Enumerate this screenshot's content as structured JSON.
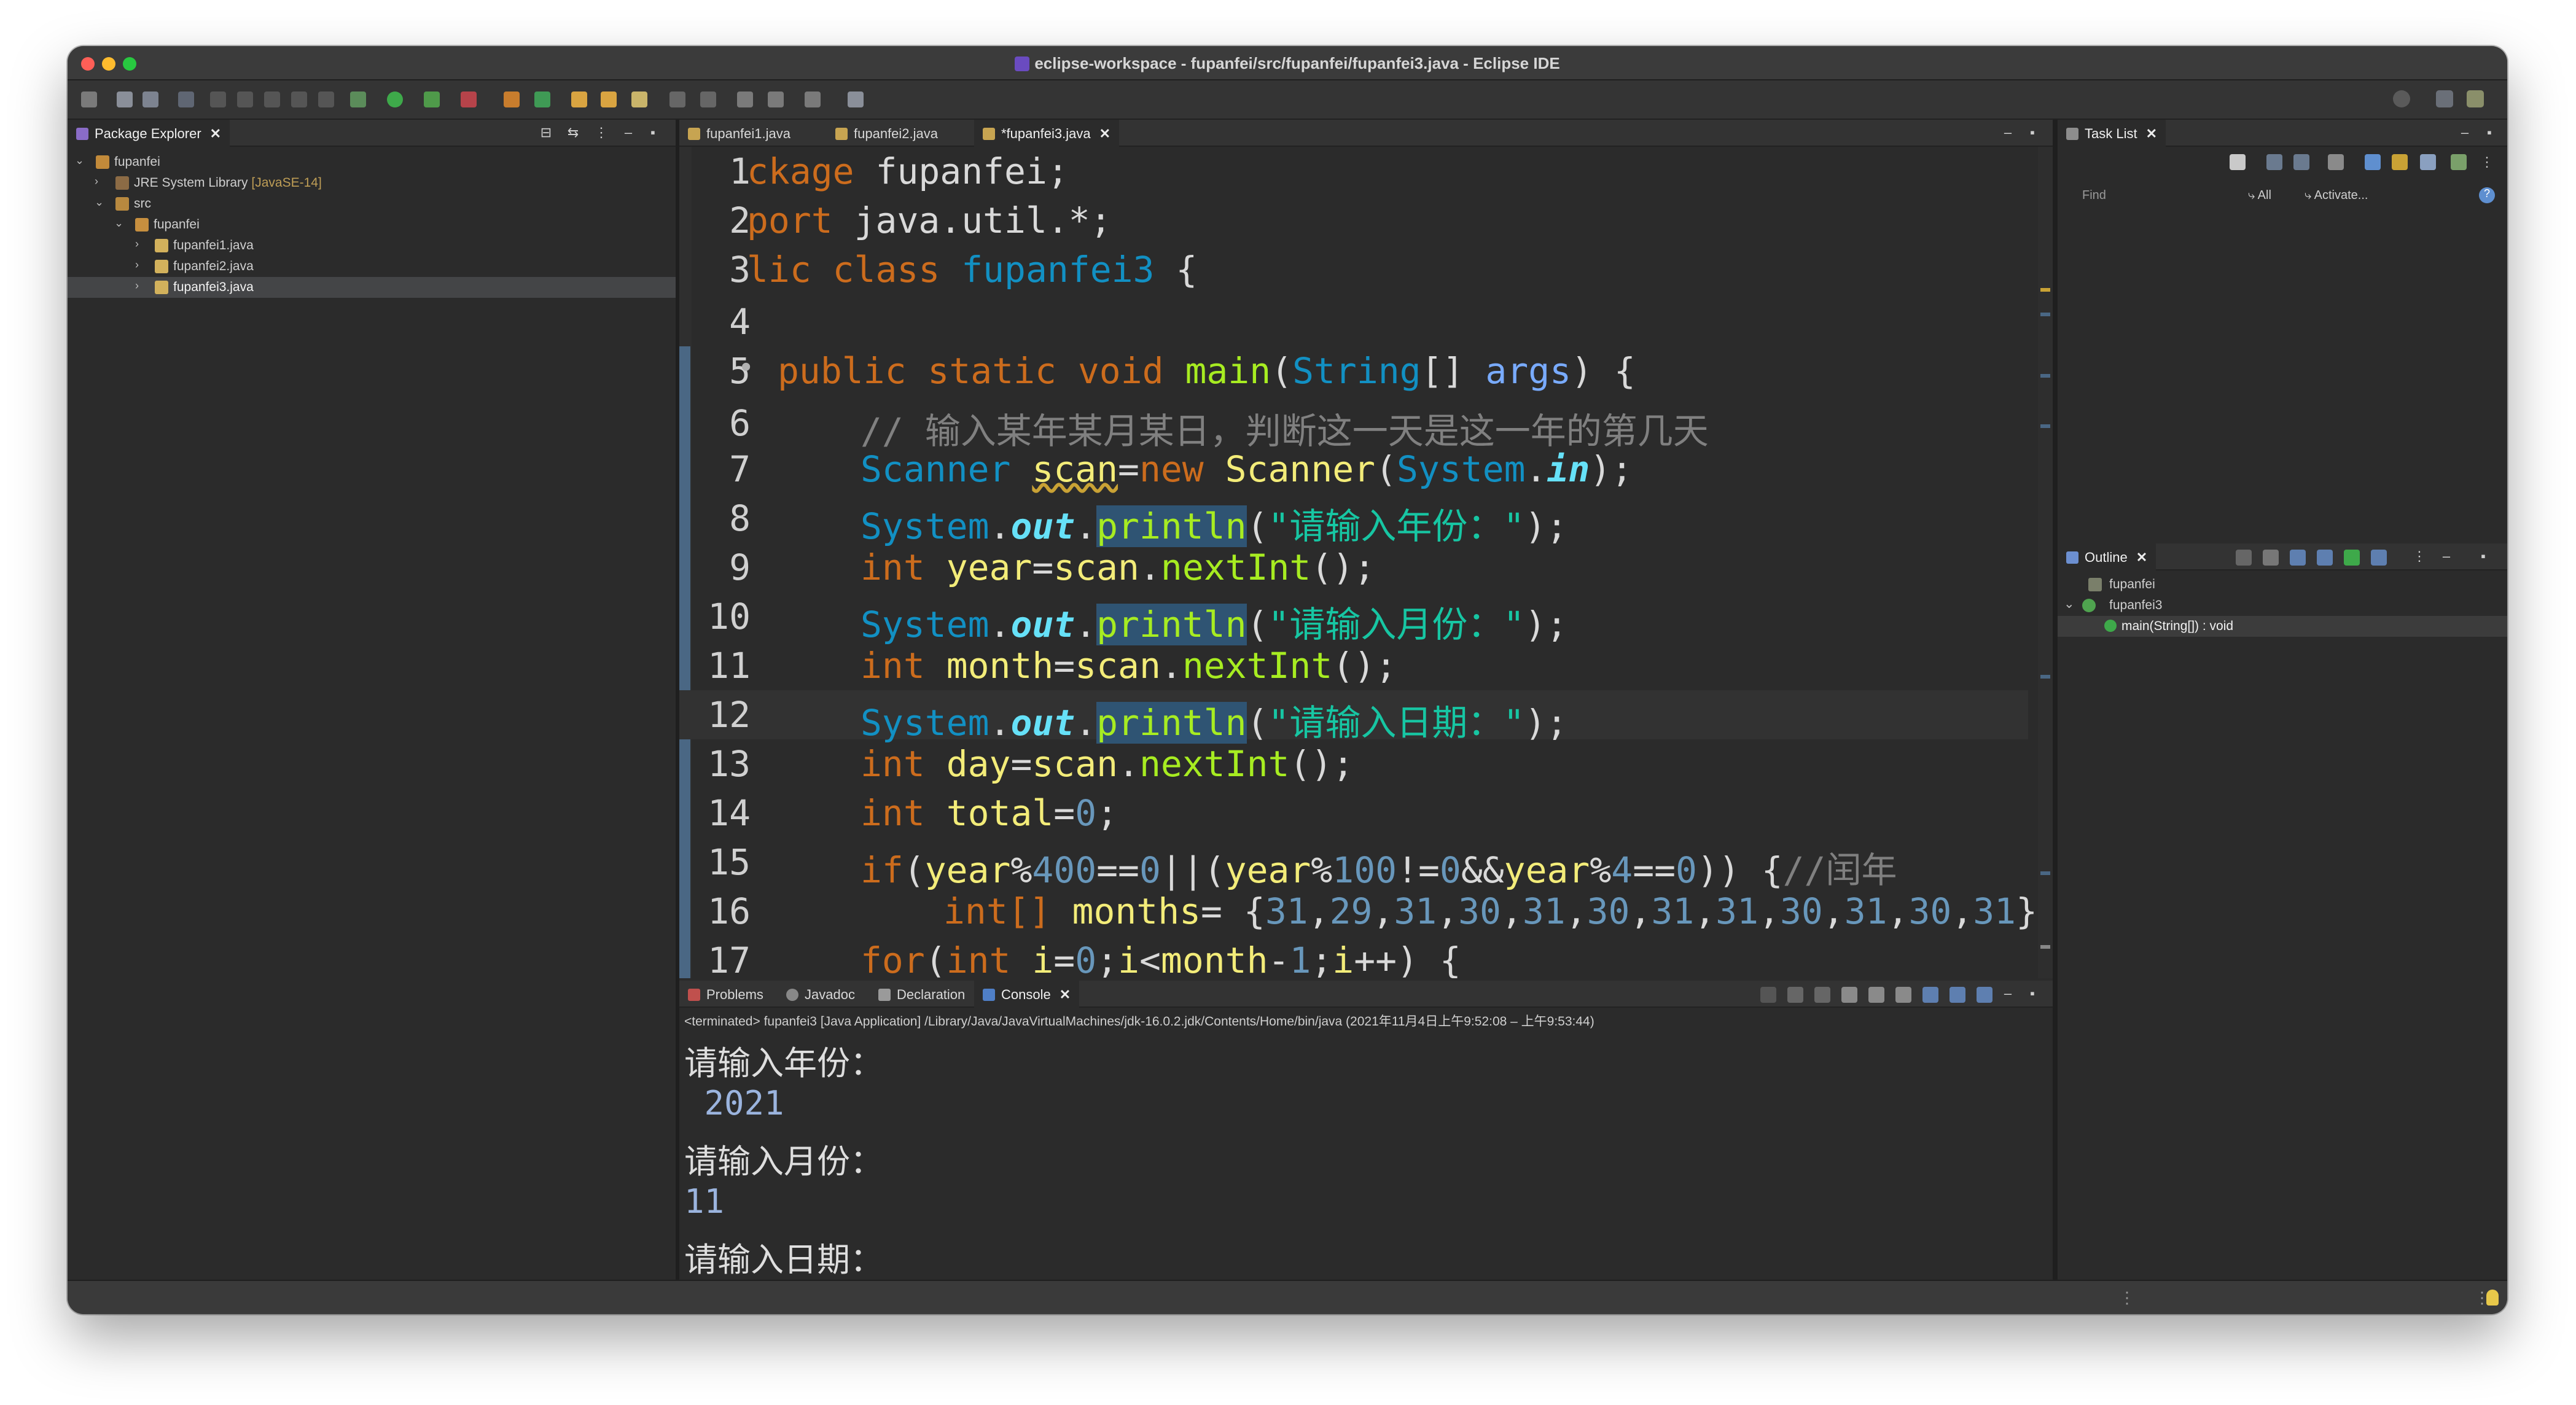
{
  "window": {
    "title": "eclipse-workspace - fupanfei/src/fupanfei/fupanfei3.java - Eclipse IDE"
  },
  "package_explorer": {
    "tab_label": "Package Explorer",
    "tree": [
      {
        "label": "fupanfei",
        "icon": "project-icon",
        "level": 0,
        "expanded": true
      },
      {
        "label": "JRE System Library",
        "suffix": "[JavaSE-14]",
        "icon": "library-icon",
        "level": 1,
        "expanded": false
      },
      {
        "label": "src",
        "icon": "source-folder-icon",
        "level": 1,
        "expanded": true
      },
      {
        "label": "fupanfei",
        "icon": "package-icon",
        "level": 2,
        "expanded": true
      },
      {
        "label": "fupanfei1.java",
        "icon": "java-file-icon",
        "level": 3,
        "expanded": false
      },
      {
        "label": "fupanfei2.java",
        "icon": "java-file-icon",
        "level": 3,
        "expanded": false
      },
      {
        "label": "fupanfei3.java",
        "icon": "java-file-icon",
        "level": 3,
        "expanded": false,
        "selected": true
      }
    ]
  },
  "editor": {
    "tabs": [
      {
        "label": "fupanfei1.java",
        "active": false
      },
      {
        "label": "fupanfei2.java",
        "active": false
      },
      {
        "label": "*fupanfei3.java",
        "active": true
      }
    ],
    "line_numbers": [
      "1",
      "2",
      "3",
      "4",
      "5",
      "6",
      "7",
      "8",
      "9",
      "10",
      "11",
      "12",
      "13",
      "14",
      "15",
      "16",
      "17"
    ],
    "code": {
      "l1_kw": "ckage",
      "l1_rest": " fupanfei;",
      "l2_kw": "port",
      "l2_rest": " java.util.*;",
      "l3_kw": "lic class",
      "l3_name": "fupanfei3",
      "l3_rest": " {",
      "l5_mods": "public static void",
      "l5_method": "main",
      "l5_type": "String",
      "l5_arr": "[]",
      "l5_param": "args",
      "l5_rest": ") {",
      "l6_comment": "// 输入某年某月某日，判断这一天是这一年的第几天",
      "l7_type": "Scanner",
      "l7_var": "scan",
      "l7_new": "new",
      "l7_ctor": "Scanner",
      "l7_sys": "System",
      "l7_in": "in",
      "l7_end": ");",
      "sys": "System",
      "out": "out",
      "println": "println",
      "l8_str": "\"请输入年份：\"",
      "l10_str": "\"请输入月份：\"",
      "l12_str": "\"请输入日期：\"",
      "int_kw": "int",
      "l9_var": "year",
      "l11_var": "month",
      "l13_var": "day",
      "scan": "scan",
      "nextInt": "nextInt",
      "l14_var": "total",
      "l14_val": "0",
      "l15_if": "if",
      "l15_year": "year",
      "n400": "400",
      "n0": "0",
      "n100": "100",
      "n4": "4",
      "l15_comment": "//闰年",
      "l16_arr": "int[]",
      "l16_var": "months",
      "l16_values": [
        "31",
        "29",
        "31",
        "30",
        "31",
        "30",
        "31",
        "31",
        "30",
        "31",
        "30",
        "31"
      ],
      "l17_for": "for",
      "l17_i": "i",
      "l17_month": "month",
      "n1": "1"
    }
  },
  "task_list": {
    "tab_label": "Task List",
    "find_placeholder": "Find",
    "filter_all": "All",
    "activate": "Activate..."
  },
  "outline": {
    "tab_label": "Outline",
    "items": [
      {
        "label": "fupanfei",
        "icon": "package-icon"
      },
      {
        "label": "fupanfei3",
        "icon": "class-icon"
      },
      {
        "label": "main(String[]) : void",
        "icon": "method-icon",
        "selected": true
      }
    ]
  },
  "bottom_panel": {
    "tabs": [
      {
        "label": "Problems",
        "icon": "problems-icon"
      },
      {
        "label": "Javadoc",
        "icon": "javadoc-icon"
      },
      {
        "label": "Declaration",
        "icon": "declaration-icon"
      },
      {
        "label": "Console",
        "icon": "console-icon",
        "active": true
      }
    ],
    "console_header": "<terminated> fupanfei3 [Java Application] /Library/Java/JavaVirtualMachines/jdk-16.0.2.jdk/Contents/Home/bin/java  (2021年11月4日上午9:52:08 – 上午9:53:44)",
    "lines": [
      {
        "text": "请输入年份：",
        "input": false
      },
      {
        "text": " 2021",
        "input": true
      },
      {
        "text": "请输入月份：",
        "input": false
      },
      {
        "text": "11",
        "input": true
      },
      {
        "text": "请输入日期：",
        "input": false
      }
    ]
  },
  "colors": {
    "keyword": "#cc6c1d",
    "type": "#1290c3",
    "method": "#a7ec21",
    "string": "#17c6a3",
    "number": "#6897bb",
    "comment": "#808080",
    "background": "#2b2b2b"
  }
}
